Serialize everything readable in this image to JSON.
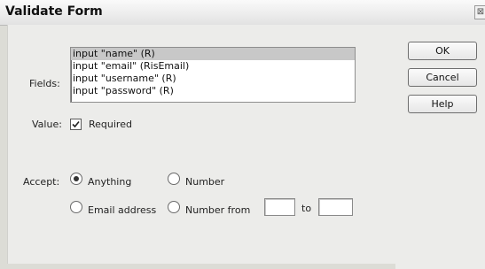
{
  "window": {
    "title": "Validate Form",
    "close_glyph": "⊠"
  },
  "fields": {
    "label": "Fields:",
    "items": [
      "input \"name\" (R)",
      "input \"email\" (RisEmail)",
      "input \"username\" (R)",
      "input \"password\" (R)"
    ],
    "selected_index": 0
  },
  "value": {
    "label": "Value:",
    "required_label": "Required",
    "required_checked": true
  },
  "accept": {
    "label": "Accept:",
    "selected": "Anything",
    "options": {
      "anything": "Anything",
      "number": "Number",
      "email": "Email address",
      "number_from": "Number from"
    },
    "to_label": "to",
    "from_value": "",
    "to_value": ""
  },
  "buttons": {
    "ok": "OK",
    "cancel": "Cancel",
    "help": "Help"
  },
  "icons": {
    "close": "close-icon",
    "check": "checkmark-icon"
  }
}
